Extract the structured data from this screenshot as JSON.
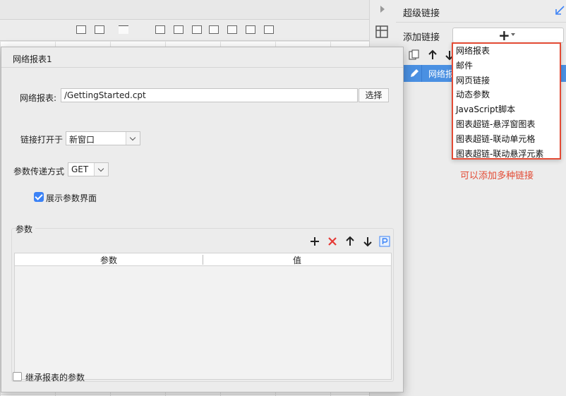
{
  "right_panel": {
    "title": "超级链接",
    "add_link_label": "添加链接",
    "add_button_icon": "plus-icon",
    "link_row_text": "网络报表1",
    "link_row_icon": "pencil-icon"
  },
  "link_menu": {
    "items": [
      "网络报表",
      "邮件",
      "网页链接",
      "动态参数",
      "JavaScript脚本",
      "图表超链-悬浮窗图表",
      "图表超链-联动单元格",
      "图表超链-联动悬浮元素"
    ],
    "hint": "可以添加多种链接",
    "highlight_color": "#e34b35"
  },
  "dialog": {
    "title": "网络报表1",
    "report_label": "网络报表:",
    "report_path": "/GettingStarted.cpt",
    "select_button": "选择",
    "open_in_label": "链接打开于",
    "open_in_value": "新窗口",
    "param_method_label": "参数传递方式",
    "param_method_value": "GET",
    "show_params_label": "展示参数界面",
    "show_params_checked": true,
    "params_group_label": "参数",
    "params_columns": [
      "参数",
      "值"
    ],
    "params_rows": [],
    "inherit_label": "继承报表的参数",
    "inherit_checked": false
  },
  "colors": {
    "accent": "#4a90e2",
    "checkbox": "#3b82f6",
    "delete": "#e53935"
  }
}
